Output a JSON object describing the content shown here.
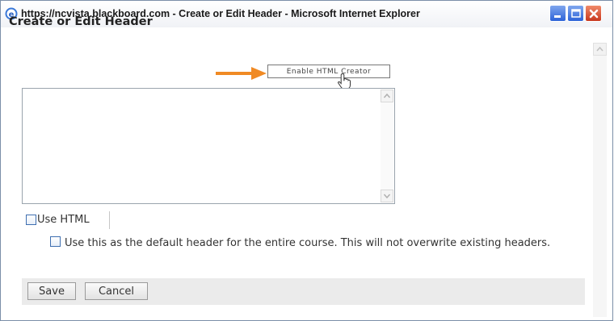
{
  "window": {
    "title": "https://ncvista.blackboard.com - Create or Edit Header - Microsoft Internet Explorer",
    "controls": [
      "minimize-icon",
      "maximize-icon",
      "close-icon"
    ]
  },
  "page": {
    "heading": "Create or Edit Header",
    "enable_html_creator_label": "Enable HTML Creator",
    "editor_value": "",
    "use_html_label": "Use HTML",
    "use_html_checked": false,
    "default_header_label": "Use this as the default header for the entire course. This will not overwrite existing headers.",
    "default_header_checked": false,
    "save_label": "Save",
    "cancel_label": "Cancel"
  },
  "colors": {
    "arrow": "#f08a24",
    "checkbox_border": "#3f6fb0",
    "button_bar": "#ebebeb"
  },
  "icons": [
    "ie-icon",
    "arrow-icon",
    "hand-cursor-icon",
    "scroll-up-icon",
    "scroll-down-icon"
  ]
}
